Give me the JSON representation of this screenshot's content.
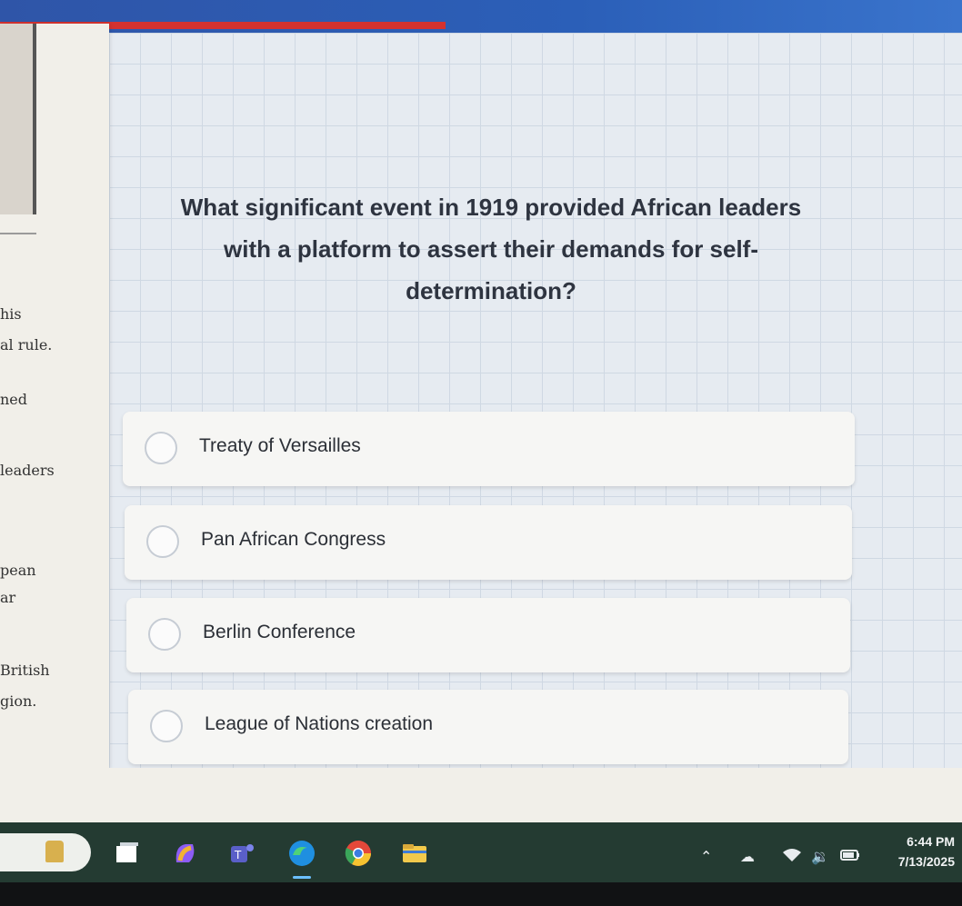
{
  "question": {
    "text": "What significant event in 1919 provided African leaders with a platform to assert their demands for self-determination?"
  },
  "options": [
    {
      "label": "Treaty of Versailles"
    },
    {
      "label": "Pan African Congress"
    },
    {
      "label": "Berlin Conference"
    },
    {
      "label": "League of Nations creation"
    }
  ],
  "sidebar": {
    "snippets": [
      "his",
      "al rule.",
      "ned",
      "leaders",
      "pean",
      "ar",
      "British",
      "gion."
    ]
  },
  "taskbar": {
    "time": "6:44 PM",
    "date": "7/13/2025",
    "icons": [
      "search-box",
      "task-view-icon",
      "copilot-icon",
      "teams-icon",
      "edge-icon",
      "chrome-icon",
      "file-explorer-icon"
    ],
    "tray": [
      "chevron-up-icon",
      "onedrive-icon",
      "wifi-icon",
      "volume-icon",
      "battery-icon"
    ]
  },
  "colors": {
    "accent_bar": "#2f55a8",
    "progress": "#d3322f",
    "taskbar": "#243b32"
  }
}
